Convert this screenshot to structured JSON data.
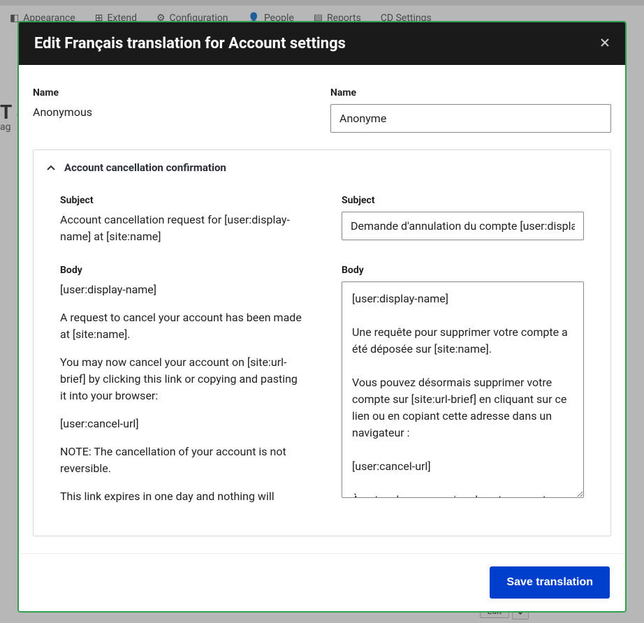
{
  "toolbar": {
    "items": [
      {
        "label": "Appearance"
      },
      {
        "label": "Extend"
      },
      {
        "label": "Configuration"
      },
      {
        "label": "People"
      },
      {
        "label": "Reports"
      },
      {
        "label": "CD Settings"
      }
    ]
  },
  "background": {
    "page_title_fragment": "T S",
    "tab_fragment": "ag",
    "edit_button": "Edit"
  },
  "modal": {
    "title": "Edit Français translation for Account settings",
    "save_button": "Save translation",
    "name": {
      "label_source": "Name",
      "value_source": "Anonymous",
      "label_target": "Name",
      "value_target": "Anonyme"
    },
    "section": {
      "title": "Account cancellation confirmation",
      "subject": {
        "label_source": "Subject",
        "value_source": "Account cancellation request for [user:display-name] at [site:name]",
        "label_target": "Subject",
        "value_target": "Demande d'annulation du compte [user:display-name] sur [site:name]"
      },
      "body": {
        "label_source": "Body",
        "label_target": "Body",
        "source_paragraphs": [
          "[user:display-name]",
          "A request to cancel your account has been made at [site:name].",
          "You may now cancel your account on [site:url-brief] by clicking this link or copying and pasting it into your browser:",
          "[user:cancel-url]",
          "NOTE: The cancellation of your account is not reversible.",
          "This link expires in one day and nothing will"
        ],
        "target_value": "[user:display-name]\n\nUne requête pour supprimer votre compte a été déposée sur [site:name].\n\nVous pouvez désormais supprimer votre compte sur [site:url-brief] en cliquant sur ce lien ou en copiant cette adresse dans un navigateur :\n\n[user:cancel-url]\n\nÀ noter : la suppression de votre compte"
      }
    }
  }
}
